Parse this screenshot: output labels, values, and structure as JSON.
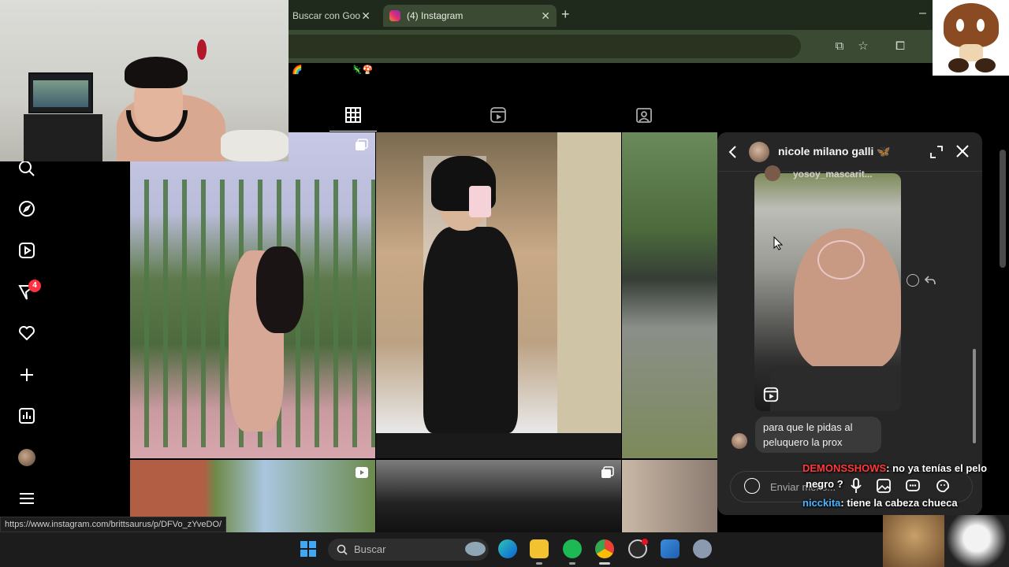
{
  "browser": {
    "tabs": [
      {
        "label": "Buscar con Goo",
        "active": false
      },
      {
        "label": "(4) Instagram",
        "active": true
      }
    ],
    "new_tab": "+",
    "minimize": "–",
    "tab_close": "✕"
  },
  "instagram": {
    "profile_tabs": [
      "grid-icon",
      "reels-icon",
      "tagged-icon"
    ],
    "active_profile_tab": "grid",
    "notification_count": "4",
    "sidebar_icons": [
      "search-icon",
      "explore-icon",
      "reels-icon",
      "messages-icon",
      "notifications-icon",
      "create-icon",
      "dashboard-icon",
      "profile-avatar",
      "menu-icon"
    ]
  },
  "dm": {
    "contact_name": "nicole milano galli 🦋",
    "shared_from": "yosoy_mascarit...",
    "message": "para que le pidas al peluquero la prox",
    "input_placeholder": "Enviar mens..."
  },
  "chat": {
    "messages": [
      {
        "user": "DEMONSSHOWS",
        "text": ": no ya tenías el pelo",
        "cont": "negro ?"
      },
      {
        "user": "nicckita",
        "text": ": tiene la cabeza chueca"
      }
    ]
  },
  "status_url": "https://www.instagram.com/brittsaurus/p/DFVo_zYveDO/",
  "taskbar": {
    "search_placeholder": "Buscar"
  },
  "colors": {
    "instagram_bg": "#000000",
    "dm_bg": "#262626",
    "chat_user1": "#ff3a3a",
    "chat_user2": "#4ab4ff",
    "browser_chrome": "#3a4a33",
    "notification_badge": "#ff3040"
  }
}
